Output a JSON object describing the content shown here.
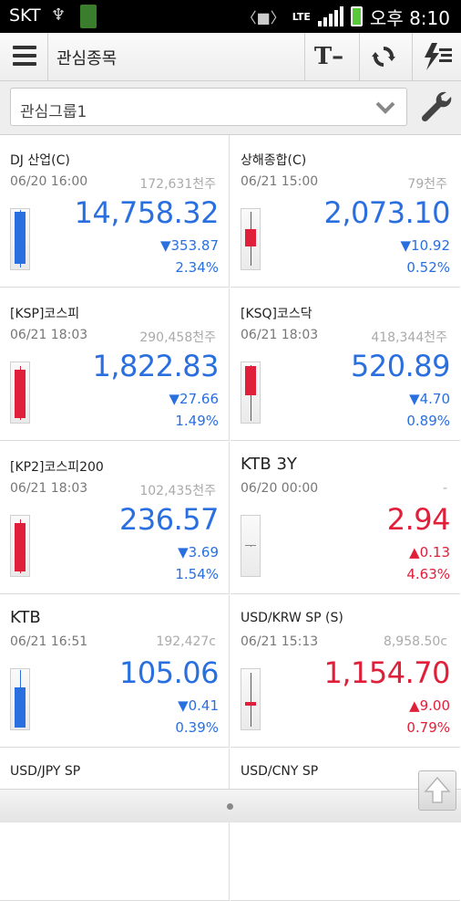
{
  "status_bar": {
    "carrier": "SKT",
    "network": "LTE",
    "time": "오후 8:10"
  },
  "app_bar": {
    "title": "관심종목",
    "icons": [
      "menu-icon",
      "font-size-icon",
      "refresh-icon",
      "flash-order-icon"
    ]
  },
  "group_selector": {
    "selected": "관심그룹1",
    "icon": "chevron-down-icon",
    "settings_icon": "wrench-icon"
  },
  "colors": {
    "up": "#e0203a",
    "down": "#2a6fe0"
  },
  "items": [
    {
      "name": "DJ 산업(C)",
      "time": "06/20 16:00",
      "volume": "172,631천주",
      "price": "14,758.32",
      "change": "▼353.87",
      "pct": "2.34%",
      "dir": "down",
      "candle": {
        "wick": [
          0.02,
          0.98
        ],
        "body": [
          0.05,
          0.92
        ],
        "up": false
      }
    },
    {
      "name": "상해종합(C)",
      "time": "06/21 15:00",
      "volume": "79천주",
      "price": "2,073.10",
      "change": "▼10.92",
      "pct": "0.52%",
      "dir": "down",
      "candle": {
        "wick": [
          0.05,
          0.95
        ],
        "body": [
          0.33,
          0.62
        ],
        "up": true
      }
    },
    {
      "name": "[KSP]코스피",
      "time": "06/21 18:03",
      "volume": "290,458천주",
      "price": "1,822.83",
      "change": "▼27.66",
      "pct": "1.49%",
      "dir": "down",
      "candle": {
        "wick": [
          0.06,
          0.95
        ],
        "body": [
          0.12,
          0.92
        ],
        "up": true
      }
    },
    {
      "name": "[KSQ]코스닥",
      "time": "06/21 18:03",
      "volume": "418,344천주",
      "price": "520.89",
      "change": "▼4.70",
      "pct": "0.89%",
      "dir": "down",
      "candle": {
        "wick": [
          0.04,
          0.96
        ],
        "body": [
          0.06,
          0.55
        ],
        "up": true
      }
    },
    {
      "name": "[KP2]코스피200",
      "time": "06/21 18:03",
      "volume": "102,435천주",
      "price": "236.57",
      "change": "▼3.69",
      "pct": "1.54%",
      "dir": "down",
      "candle": {
        "wick": [
          0.06,
          0.95
        ],
        "body": [
          0.12,
          0.92
        ],
        "up": true
      }
    },
    {
      "name": "KTB 3Y",
      "time": "06/20 00:00",
      "volume": "-",
      "price": "2.94",
      "change": "▲0.13",
      "pct": "4.63%",
      "dir": "up",
      "big_name": true,
      "candle": {
        "wick": [
          0.5,
          0.5
        ],
        "body": [
          0.49,
          0.51
        ],
        "up": null
      }
    },
    {
      "name": "KTB",
      "time": "06/21 16:51",
      "volume": "192,427c",
      "price": "105.06",
      "change": "▼0.41",
      "pct": "0.39%",
      "dir": "down",
      "big_name": true,
      "candle": {
        "wick": [
          0.02,
          0.98
        ],
        "body": [
          0.3,
          0.96
        ],
        "up": false
      }
    },
    {
      "name": "USD/KRW SP (S)",
      "time": "06/21 15:13",
      "volume": "8,958.50c",
      "price": "1,154.70",
      "change": "▲9.00",
      "pct": "0.79%",
      "dir": "up",
      "candle": {
        "wick": [
          0.06,
          0.96
        ],
        "body": [
          0.54,
          0.6
        ],
        "up": true
      }
    },
    {
      "name": "USD/JPY SP",
      "partial": true
    },
    {
      "name": "USD/CNY SP",
      "partial": true
    }
  ]
}
